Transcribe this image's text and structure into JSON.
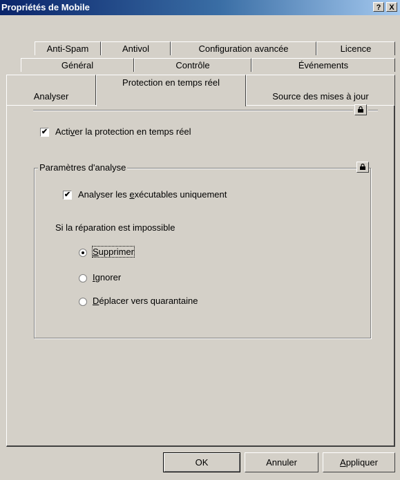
{
  "window": {
    "title": "Propriétés de Mobile",
    "help_button": "?",
    "close_button": "X"
  },
  "tabs": {
    "row1": [
      "Anti-Spam",
      "Antivol",
      "Configuration avancée",
      "Licence"
    ],
    "row2": [
      "Général",
      "Contrôle",
      "Événements"
    ],
    "row3": [
      "Analyser",
      "Protection en temps réel",
      "Source des mises à jour"
    ],
    "active": "Protection en temps réel"
  },
  "realtime": {
    "enable_label_pre": "Acti",
    "enable_label_key": "v",
    "enable_label_post": "er la protection en temps réel",
    "enable_checked": true
  },
  "scan_settings": {
    "group_title": "Paramètres d'analyse",
    "exec_label_pre": "Analyser les ",
    "exec_label_key": "e",
    "exec_label_post": "xécutables uniquement",
    "exec_checked": true,
    "repair_heading": "Si la réparation est impossible",
    "options": [
      {
        "key": "S",
        "rest": "upprimer",
        "selected": true
      },
      {
        "key": "I",
        "rest": "gnorer",
        "selected": false
      },
      {
        "key": "D",
        "rest": "éplacer vers quarantaine",
        "selected": false
      }
    ]
  },
  "buttons": {
    "ok": "OK",
    "cancel": "Annuler",
    "apply_key": "A",
    "apply_rest": "ppliquer"
  },
  "icons": {
    "lock": "lock-icon",
    "check": "check-icon"
  }
}
